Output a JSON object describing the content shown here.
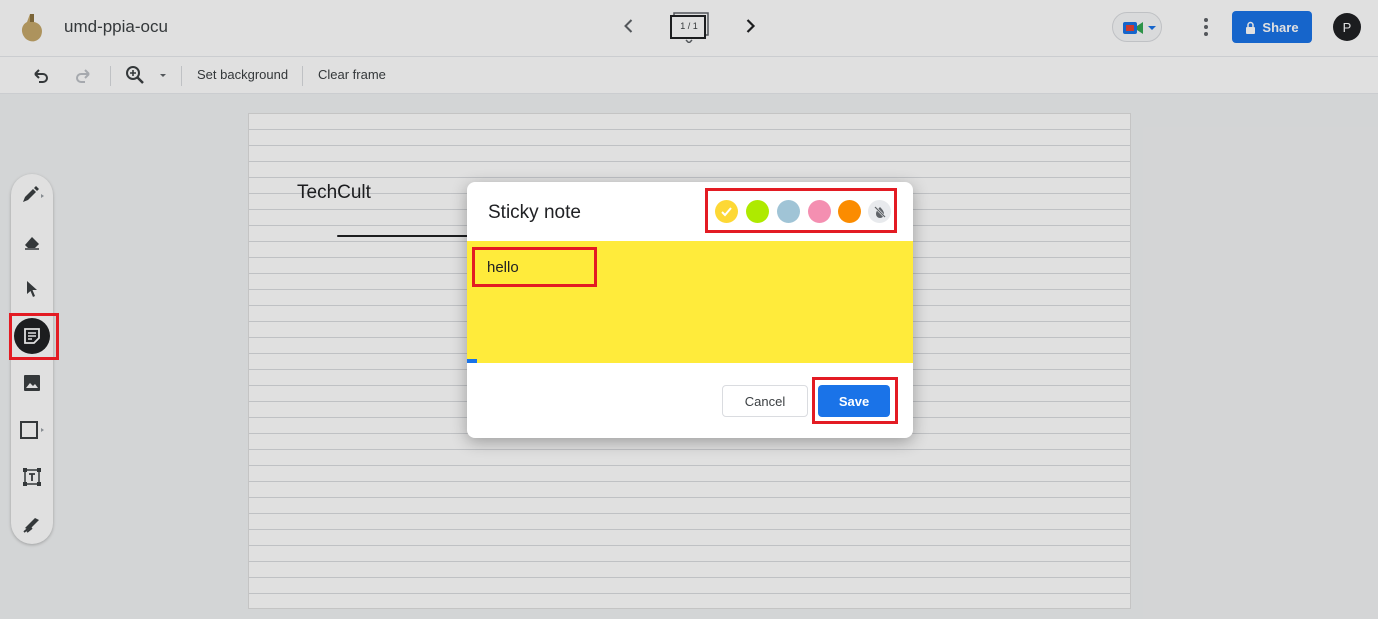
{
  "header": {
    "doc_title": "umd-ppia-ocu",
    "frame_counter": "1 / 1",
    "share_label": "Share",
    "avatar_initial": "P"
  },
  "toolbar": {
    "set_background_label": "Set background",
    "clear_frame_label": "Clear frame"
  },
  "canvas": {
    "text": "TechCult"
  },
  "tools": {
    "items": [
      "pen-icon",
      "eraser-icon",
      "select-icon",
      "sticky-note-icon",
      "image-icon",
      "shape-icon",
      "text-box-icon",
      "laser-icon"
    ],
    "active": "sticky-note-icon"
  },
  "dialog": {
    "title": "Sticky note",
    "note_text": "hello",
    "cancel_label": "Cancel",
    "save_label": "Save",
    "selected_color": "#fdd835",
    "colors": [
      "#fdd835",
      "#aeea00",
      "#a0c4d6",
      "#f48fb1",
      "#fb8c00"
    ]
  },
  "colors": {
    "accent": "#1a73e8",
    "note_background": "#ffeb3b",
    "highlight": "#e31b23"
  }
}
